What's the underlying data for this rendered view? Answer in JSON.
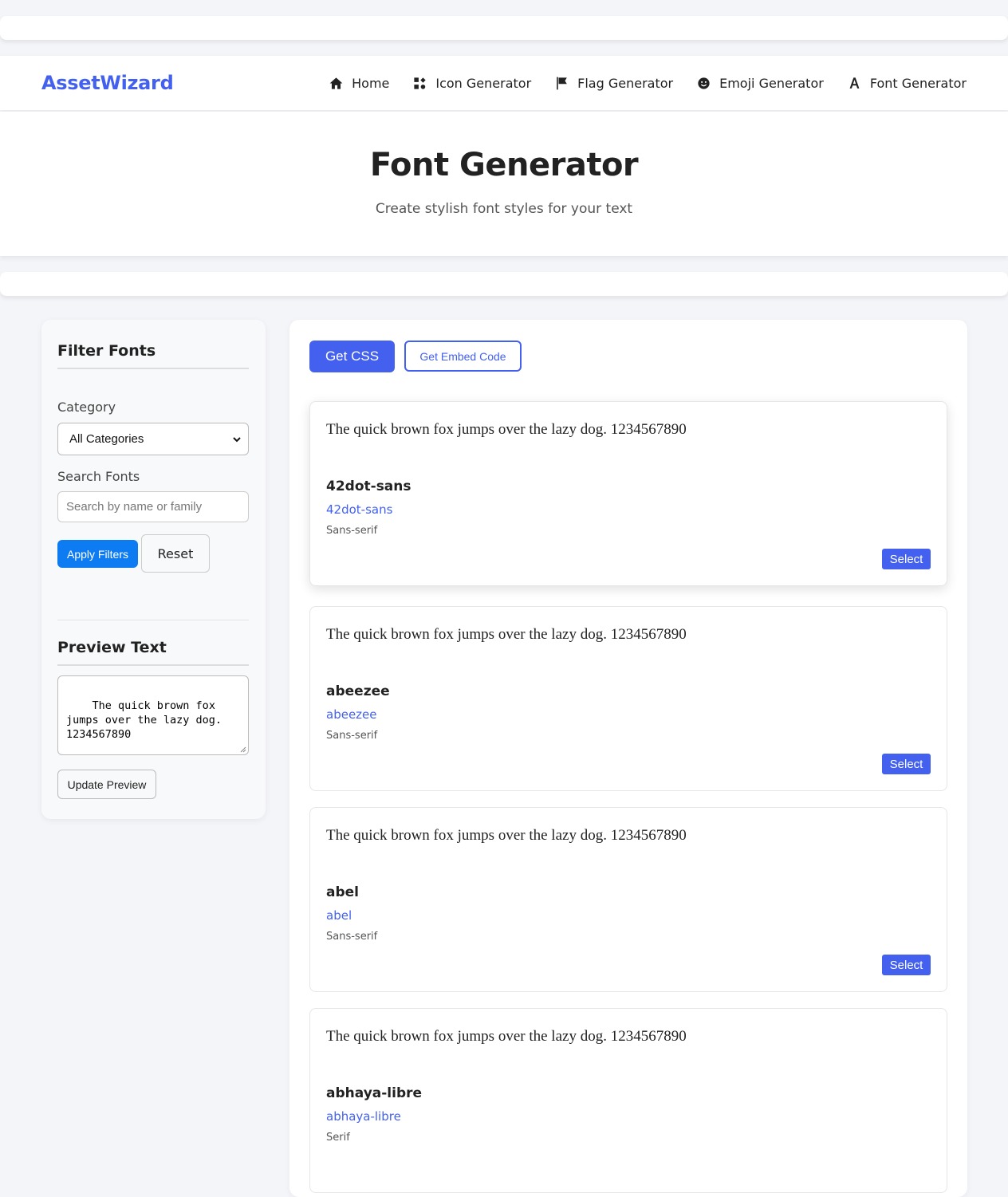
{
  "brand": "AssetWizard",
  "nav": [
    {
      "label": "Home",
      "icon": "home-icon"
    },
    {
      "label": "Icon Generator",
      "icon": "shapes-icon"
    },
    {
      "label": "Flag Generator",
      "icon": "flag-icon"
    },
    {
      "label": "Emoji Generator",
      "icon": "smile-icon"
    },
    {
      "label": "Font Generator",
      "icon": "font-icon"
    }
  ],
  "hero": {
    "title": "Font Generator",
    "subtitle": "Create stylish font styles for your text"
  },
  "sidebar": {
    "filter_title": "Filter Fonts",
    "category_label": "Category",
    "category_value": "All Categories",
    "search_label": "Search Fonts",
    "search_placeholder": "Search by name or family",
    "apply_label": "Apply Filters",
    "reset_label": "Reset",
    "preview_title": "Preview Text",
    "preview_text": "The quick brown fox jumps over the lazy dog. 1234567890",
    "update_label": "Update Preview"
  },
  "main": {
    "get_css_label": "Get CSS",
    "get_embed_label": "Get Embed Code",
    "select_label": "Select",
    "cards": [
      {
        "preview": "The quick brown fox jumps over the lazy dog. 1234567890",
        "name": "42dot-sans",
        "family": "42dot-sans",
        "category": "Sans-serif"
      },
      {
        "preview": "The quick brown fox jumps over the lazy dog. 1234567890",
        "name": "abeezee",
        "family": "abeezee",
        "category": "Sans-serif"
      },
      {
        "preview": "The quick brown fox jumps over the lazy dog. 1234567890",
        "name": "abel",
        "family": "abel",
        "category": "Sans-serif"
      },
      {
        "preview": "The quick brown fox jumps over the lazy dog. 1234567890",
        "name": "abhaya-libre",
        "family": "abhaya-libre",
        "category": "Serif"
      }
    ]
  },
  "colors": {
    "accent": "#4361ee",
    "apply_blue": "#0d7cf2",
    "page_bg": "#f4f5f9"
  }
}
